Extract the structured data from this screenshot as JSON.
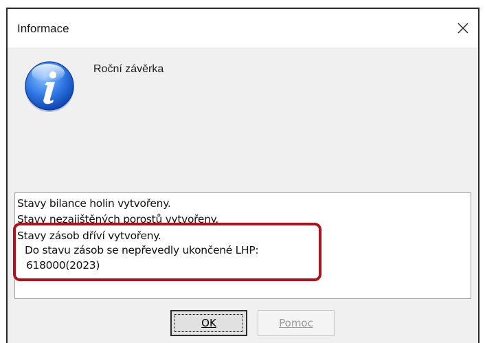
{
  "dialog": {
    "title": "Informace",
    "close_symbol": "✕",
    "icon": "info-icon",
    "heading": "Roční závěrka"
  },
  "log": {
    "lines": [
      "Stavy bilance holin vytvořeny.",
      "Stavy nezajištěných porostů vytvořeny.",
      "Stavy zásob dříví vytvořeny.",
      "Do stavu zásob se nepřevedly ukončené LHP:",
      "618000(2023)"
    ]
  },
  "buttons": {
    "ok_label": "OK",
    "help_label": "Pomoc"
  },
  "colors": {
    "highlight": "#b0121d",
    "icon_blue": "#1c5fd6"
  }
}
